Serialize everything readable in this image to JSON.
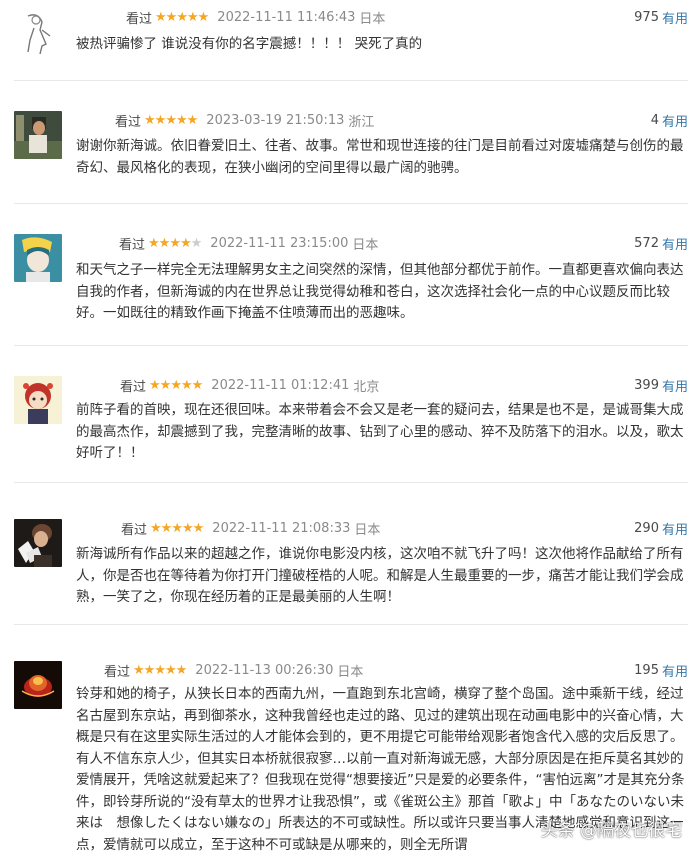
{
  "reviews": [
    {
      "status": "看过",
      "stars_on": "★★★★★",
      "stars_off": "",
      "time": "2022-11-11 11:46:43",
      "location": "日本",
      "votes": "975",
      "votes_label": "有用",
      "content": "被热评骗惨了 谁说没有你的名字震撼！！！！ 哭死了真的"
    },
    {
      "status": "看过",
      "stars_on": "★★★★★",
      "stars_off": "",
      "time": "2023-03-19 21:50:13",
      "location": "浙江",
      "votes": "4",
      "votes_label": "有用",
      "content": "谢谢你新海诚。依旧眷爱旧土、往者、故事。常世和现世连接的往门是目前看过对废墟痛楚与创伤的最奇幻、最风格化的表现，在狭小幽闭的空间里得以最广阔的驰骋。"
    },
    {
      "status": "看过",
      "stars_on": "★★★★",
      "stars_off": "★",
      "time": "2022-11-11 23:15:00",
      "location": "日本",
      "votes": "572",
      "votes_label": "有用",
      "content": "和天气之子一样完全无法理解男女主之间突然的深情，但其他部分都优于前作。一直都更喜欢偏向表达自我的作者，但新海诚的内在世界总让我觉得幼稚和苍白，这次选择社会化一点的中心议题反而比较好。一如既往的精致作画下掩盖不住喷薄而出的恶趣味。"
    },
    {
      "status": "看过",
      "stars_on": "★★★★★",
      "stars_off": "",
      "time": "2022-11-11 01:12:41",
      "location": "北京",
      "votes": "399",
      "votes_label": "有用",
      "content": "前阵子看的首映，现在还很回味。本来带着会不会又是老一套的疑问去，结果是也不是，是诚哥集大成的最高杰作，却震撼到了我，完整清晰的故事、钻到了心里的感动、猝不及防落下的泪水。以及，歌太好听了！！"
    },
    {
      "status": "看过",
      "stars_on": "★★★★★",
      "stars_off": "",
      "time": "2022-11-11 21:08:33",
      "location": "日本",
      "votes": "290",
      "votes_label": "有用",
      "content": "新海诚所有作品以来的超越之作，谁说你电影没内核，这次咱不就飞升了吗！这次他将作品献给了所有人，你是否也在等待着为你打开门撞破桎梏的人呢。和解是人生最重要的一步，痛苦才能让我们学会成熟，一笑了之，你现在经历着的正是最美丽的人生啊！"
    },
    {
      "status": "看过",
      "stars_on": "★★★★★",
      "stars_off": "",
      "time": "2022-11-13 00:26:30",
      "location": "日本",
      "votes": "195",
      "votes_label": "有用",
      "content": "铃芽和她的椅子，从狭长日本的西南九州，一直跑到东北宫崎，横穿了整个岛国。途中乘新干线，经过名古屋到东京站，再到御茶水，这种我曾经也走过的路、见过的建筑出现在动画电影中的兴奋心情，大概是只有在这里实际生活过的人才能体会到的，更不用提它可能带给观影者饱含代入感的灾后反思了。有人不信东京人少，但其实日本桥就很寂寥…以前一直对新海诚无感，大部分原因是在拒斥莫名其妙的爱情展开，凭啥这就爱起来了？但我现在觉得“想要接近”只是爱的必要条件，“害怕远离”才是其充分条件，即铃芽所说的“没有草太的世界才让我恐惧”，或《雀斑公主》那首「歌よ」中「あなたのいない未来は　想像したくはない嫌なの」所表达的不可或缺性。所以或许只要当事人清楚地感觉和意识到这一点，爱情就可以成立，至于这种不可或缺是从哪来的，则全无所谓"
    }
  ],
  "watermark": {
    "text": "头条 @隔夜也很宅"
  },
  "colors": {
    "star": "#f5a623",
    "link": "#3377aa",
    "muted": "#8a8a8a"
  }
}
